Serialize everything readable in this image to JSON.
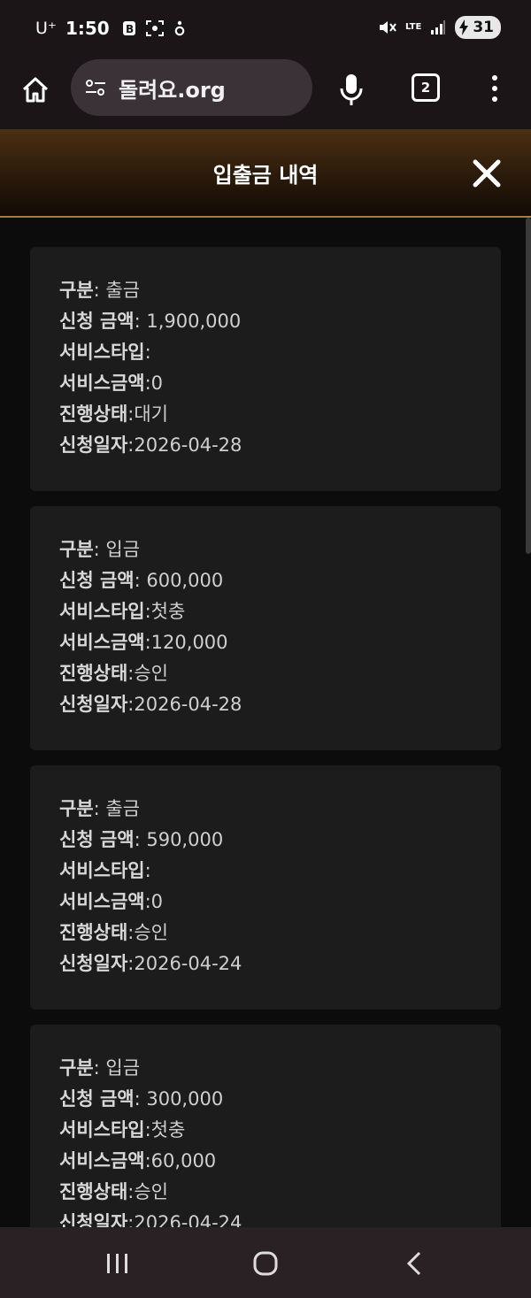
{
  "status_bar": {
    "carrier": "U⁺",
    "time": "1:50",
    "network": "LTE",
    "battery": "31"
  },
  "browser": {
    "url": "돌려요.org",
    "tab_count": "2"
  },
  "page": {
    "title": "입출금 내역"
  },
  "labels": {
    "type": "구분",
    "amount": "신청 금액",
    "service_type": "서비스타입",
    "service_amount": "서비스금액",
    "status": "진행상태",
    "date": "신청일자"
  },
  "records": [
    {
      "type": ": 출금",
      "amount": ": 1,900,000",
      "service_type": ":",
      "service_amount": ":0",
      "status": ":대기",
      "date": ":2026-04-28"
    },
    {
      "type": ": 입금",
      "amount": ": 600,000",
      "service_type": ":첫충",
      "service_amount": ":120,000",
      "status": ":승인",
      "date": ":2026-04-28"
    },
    {
      "type": ": 출금",
      "amount": ": 590,000",
      "service_type": ":",
      "service_amount": ":0",
      "status": ":승인",
      "date": ":2026-04-24"
    },
    {
      "type": ": 입금",
      "amount": ": 300,000",
      "service_type": ":첫충",
      "service_amount": ":60,000",
      "status": ":승인",
      "date": ":2026-04-24"
    }
  ],
  "colors": {
    "header_gold": "#a87a3c",
    "card_bg": "#1c1c1c",
    "page_bg": "#0c0c0c"
  }
}
